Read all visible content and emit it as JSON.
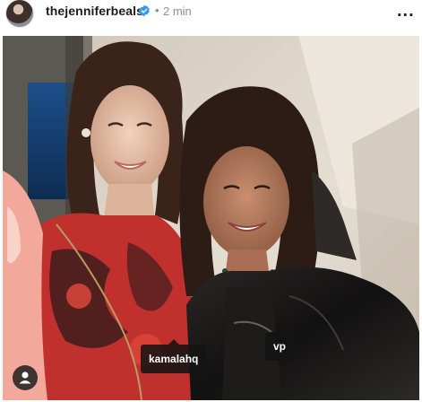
{
  "header": {
    "username": "thejenniferbeals",
    "verified_icon": "verified-badge-icon",
    "separator": "•",
    "time": "2 min",
    "more_icon": "more-options-icon",
    "more_glyph": "..."
  },
  "post": {
    "image_alt": "Photo of two women smiling",
    "tags": [
      {
        "label": "kamalahq"
      },
      {
        "label": "vp"
      }
    ],
    "tags_button_icon": "user-tag-icon"
  },
  "colors": {
    "verified_blue": "#3897f0",
    "tag_bg": "#141414",
    "text_primary": "#1c1c1c",
    "text_secondary": "#8e8e8e"
  }
}
